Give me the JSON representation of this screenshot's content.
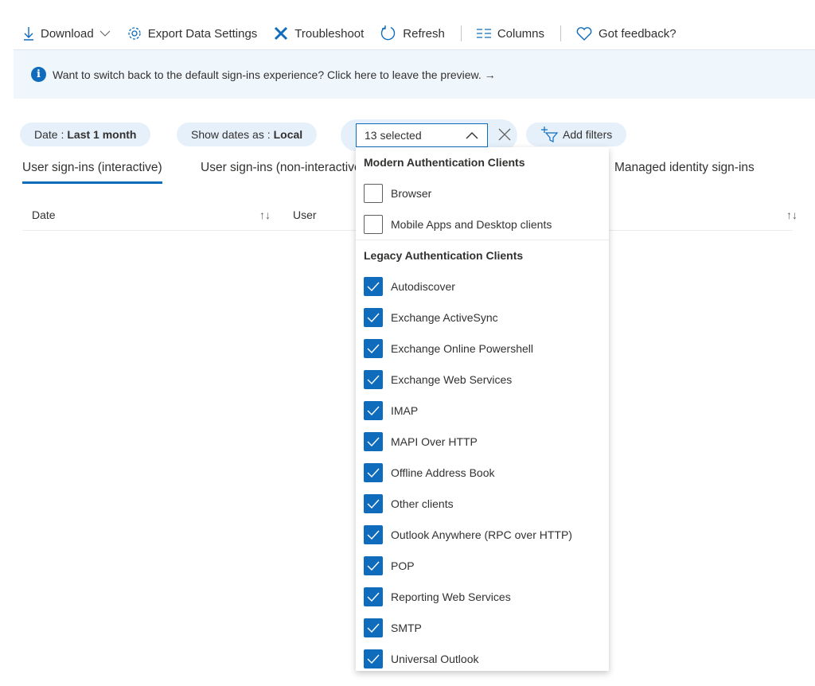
{
  "toolbar": {
    "download": "Download",
    "export": "Export Data Settings",
    "troubleshoot": "Troubleshoot",
    "refresh": "Refresh",
    "columns": "Columns",
    "feedback": "Got feedback?"
  },
  "banner": {
    "text": "Want to switch back to the default sign-ins experience? Click here to leave the preview. →"
  },
  "filters": {
    "date_label": "Date :",
    "date_value": "Last 1 month",
    "showdates_label": "Show dates as :",
    "showdates_value": "Local",
    "select_value": "13 selected",
    "add_filters": "Add filters"
  },
  "tabs": [
    "User sign-ins (interactive)",
    "User sign-ins (non-interactive)",
    "Managed identity sign-ins"
  ],
  "table": {
    "columns": [
      "Date",
      "User"
    ]
  },
  "dropdown": {
    "groups": [
      {
        "label": "Modern Authentication Clients",
        "options": [
          {
            "label": "Browser",
            "checked": false
          },
          {
            "label": "Mobile Apps and Desktop clients",
            "checked": false
          }
        ]
      },
      {
        "label": "Legacy Authentication Clients",
        "options": [
          {
            "label": "Autodiscover",
            "checked": true
          },
          {
            "label": "Exchange ActiveSync",
            "checked": true
          },
          {
            "label": "Exchange Online Powershell",
            "checked": true
          },
          {
            "label": "Exchange Web Services",
            "checked": true
          },
          {
            "label": "IMAP",
            "checked": true
          },
          {
            "label": "MAPI Over HTTP",
            "checked": true
          },
          {
            "label": "Offline Address Book",
            "checked": true
          },
          {
            "label": "Other clients",
            "checked": true
          },
          {
            "label": "Outlook Anywhere (RPC over HTTP)",
            "checked": true
          },
          {
            "label": "POP",
            "checked": true
          },
          {
            "label": "Reporting Web Services",
            "checked": true
          },
          {
            "label": "SMTP",
            "checked": true
          },
          {
            "label": "Universal Outlook",
            "checked": true
          }
        ]
      }
    ]
  },
  "colors": {
    "accent": "#0f6cbd",
    "pill": "#e6f0fa",
    "banner": "#eff6fc"
  }
}
